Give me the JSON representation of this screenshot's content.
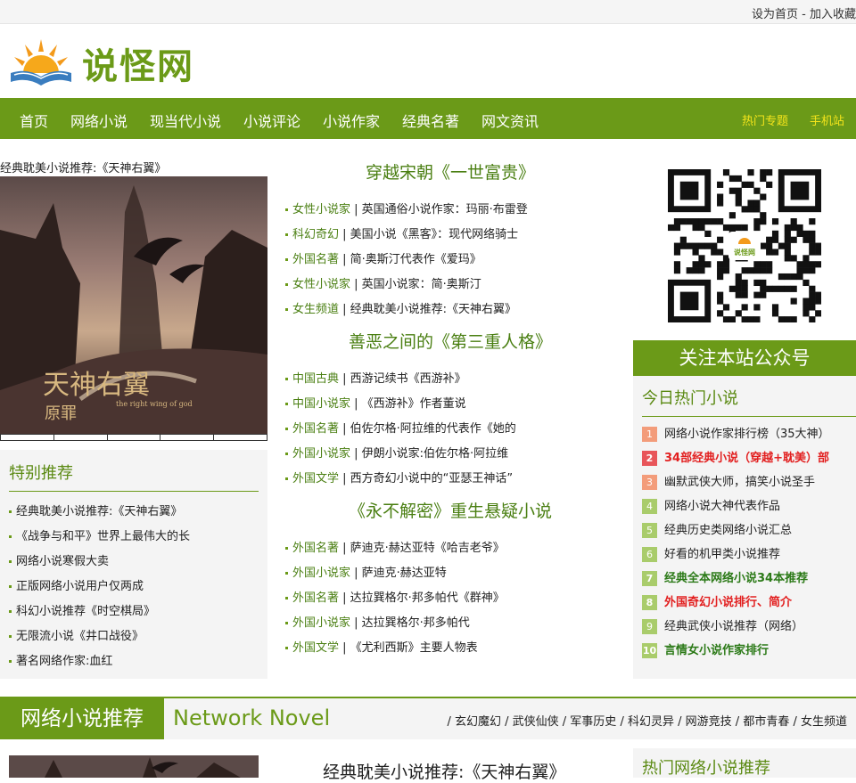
{
  "topbar": {
    "set_home": "设为首页",
    "sep": " - ",
    "add_fav": "加入收藏"
  },
  "site": {
    "name": "说怪网"
  },
  "nav": {
    "items": [
      "首页",
      "网络小说",
      "现当代小说",
      "小说评论",
      "小说作家",
      "经典名著",
      "网文资讯"
    ],
    "right": [
      "热门专题",
      "手机站"
    ]
  },
  "feature": {
    "caption": "经典耽美小说推荐:《天神右翼》",
    "cover_title": "天神右翼",
    "cover_sub": "原罪",
    "cover_en": "the right wing of god"
  },
  "special": {
    "title": "特别推荐",
    "items": [
      "经典耽美小说推荐:《天神右翼》",
      "《战争与和平》世界上最伟大的长",
      "网络小说寒假大卖",
      "正版网络小说用户仅两成",
      "科幻小说推荐《时空棋局》",
      "无限流小说《井口战役》",
      "著名网络作家:血红"
    ]
  },
  "sections": [
    {
      "title": "穿越宋朝《一世富贵》",
      "items": [
        {
          "cat": "女性小说家",
          "text": "英国通俗小说作家：玛丽·布雷登"
        },
        {
          "cat": "科幻奇幻",
          "text": "美国小说《黑客》：现代网络骑士"
        },
        {
          "cat": "外国名著",
          "text": "简·奥斯汀代表作《爱玛》"
        },
        {
          "cat": "女性小说家",
          "text": "英国小说家：简·奥斯汀"
        },
        {
          "cat": "女生频道",
          "text": "经典耽美小说推荐:《天神右翼》"
        }
      ]
    },
    {
      "title": "善恶之间的《第三重人格》",
      "items": [
        {
          "cat": "中国古典",
          "text": "西游记续书《西游补》"
        },
        {
          "cat": "中国小说家",
          "text": "《西游补》作者董说"
        },
        {
          "cat": "外国名著",
          "text": "伯佐尔格·阿拉维的代表作《她的"
        },
        {
          "cat": "外国小说家",
          "text": "伊朗小说家:伯佐尔格·阿拉维"
        },
        {
          "cat": "外国文学",
          "text": "西方奇幻小说中的“亚瑟王神话”"
        }
      ]
    },
    {
      "title": "《永不解密》重生悬疑小说",
      "items": [
        {
          "cat": "外国名著",
          "text": "萨迪克·赫达亚特《哈吉老爷》"
        },
        {
          "cat": "外国小说家",
          "text": "萨迪克·赫达亚特"
        },
        {
          "cat": "外国名著",
          "text": "达拉巽格尔·邦多帕代《群神》"
        },
        {
          "cat": "外国小说家",
          "text": "达拉巽格尔·邦多帕代"
        },
        {
          "cat": "外国文学",
          "text": "《尤利西斯》主要人物表"
        }
      ]
    }
  ],
  "sidebar": {
    "qr_label": "说怪网",
    "follow": "关注本站公众号",
    "hot_title": "今日热门小说",
    "hot": [
      {
        "n": "1",
        "text": "网络小说作家排行榜（35大神）",
        "style": "normal",
        "color": "#f39c7a"
      },
      {
        "n": "2",
        "text": "34部经典小说（穿越+耽美）部",
        "style": "red",
        "color": "#e8555a"
      },
      {
        "n": "3",
        "text": "幽默武侠大师，搞笑小说圣手",
        "style": "normal",
        "color": "#f39c7a"
      },
      {
        "n": "4",
        "text": "网络小说大神代表作品",
        "style": "normal",
        "color": "#a9cc6b"
      },
      {
        "n": "5",
        "text": "经典历史类网络小说汇总",
        "style": "normal",
        "color": "#a9cc6b"
      },
      {
        "n": "6",
        "text": "好看的机甲类小说推荐",
        "style": "normal",
        "color": "#a9cc6b"
      },
      {
        "n": "7",
        "text": "经典全本网络小说34本推荐",
        "style": "green",
        "color": "#a9cc6b"
      },
      {
        "n": "8",
        "text": "外国奇幻小说排行、简介",
        "style": "red",
        "color": "#a9cc6b"
      },
      {
        "n": "9",
        "text": "经典武侠小说推荐（网络）",
        "style": "normal",
        "color": "#a9cc6b"
      },
      {
        "n": "10",
        "text": "言情女小说作家排行",
        "style": "green",
        "color": "#a9cc6b"
      }
    ]
  },
  "network": {
    "label": "网络小说推荐",
    "en": "Network Novel",
    "tags": [
      "玄幻魔幻",
      "武侠仙侠",
      "军事历史",
      "科幻灵异",
      "网游竞技",
      "都市青春",
      "女生频道"
    ],
    "feature_title": "经典耽美小说推荐:《天神右翼》",
    "hot_title": "热门网络小说推荐"
  },
  "colors": {
    "brand": "#6b9a18",
    "accent": "#f5e51b"
  }
}
